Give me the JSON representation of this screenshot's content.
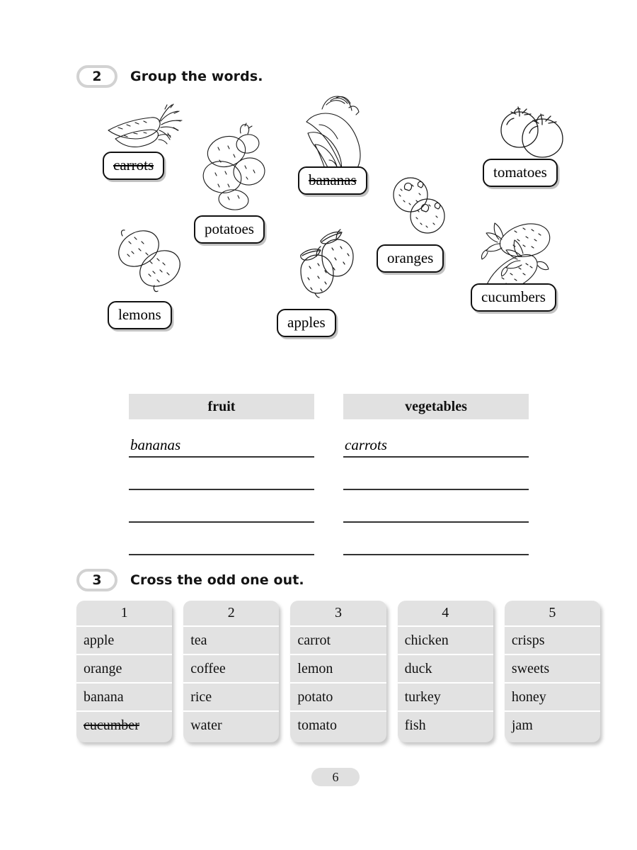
{
  "page": {
    "number": "6"
  },
  "exercises": [
    {
      "number": "2",
      "instruction": "Group the words."
    },
    {
      "number": "3",
      "instruction": "Cross the odd one out."
    }
  ],
  "picture_words": [
    {
      "label": "carrots",
      "icon": "carrots-illustration",
      "struck": true
    },
    {
      "label": "potatoes",
      "icon": "potatoes-illustration",
      "struck": false
    },
    {
      "label": "bananas",
      "icon": "bananas-illustration",
      "struck": true
    },
    {
      "label": "tomatoes",
      "icon": "tomatoes-illustration",
      "struck": false
    },
    {
      "label": "lemons",
      "icon": "lemons-illustration",
      "struck": false
    },
    {
      "label": "apples",
      "icon": "apples-illustration",
      "struck": false
    },
    {
      "label": "oranges",
      "icon": "oranges-illustration",
      "struck": false
    },
    {
      "label": "cucumbers",
      "icon": "cucumbers-illustration",
      "struck": false
    }
  ],
  "sort_table": {
    "columns": [
      {
        "header": "fruit",
        "answers": [
          "bananas",
          "",
          "",
          ""
        ]
      },
      {
        "header": "vegetables",
        "answers": [
          "carrots",
          "",
          "",
          ""
        ]
      }
    ]
  },
  "odd_one_out": [
    {
      "number": "1",
      "words": [
        {
          "text": "apple",
          "struck": false
        },
        {
          "text": "orange",
          "struck": false
        },
        {
          "text": "banana",
          "struck": false
        },
        {
          "text": "cucumber",
          "struck": true
        }
      ]
    },
    {
      "number": "2",
      "words": [
        {
          "text": "tea",
          "struck": false
        },
        {
          "text": "coffee",
          "struck": false
        },
        {
          "text": "rice",
          "struck": false
        },
        {
          "text": "water",
          "struck": false
        }
      ]
    },
    {
      "number": "3",
      "words": [
        {
          "text": "carrot",
          "struck": false
        },
        {
          "text": "lemon",
          "struck": false
        },
        {
          "text": "potato",
          "struck": false
        },
        {
          "text": "tomato",
          "struck": false
        }
      ]
    },
    {
      "number": "4",
      "words": [
        {
          "text": "chicken",
          "struck": false
        },
        {
          "text": "duck",
          "struck": false
        },
        {
          "text": "turkey",
          "struck": false
        },
        {
          "text": "fish",
          "struck": false
        }
      ]
    },
    {
      "number": "5",
      "words": [
        {
          "text": "crisps",
          "struck": false
        },
        {
          "text": "sweets",
          "struck": false
        },
        {
          "text": "honey",
          "struck": false
        },
        {
          "text": "jam",
          "struck": false
        }
      ]
    }
  ],
  "colors": {
    "gray_fill": "#e1e1e1",
    "badge_border": "#d2d2d2",
    "ink": "#111111"
  }
}
